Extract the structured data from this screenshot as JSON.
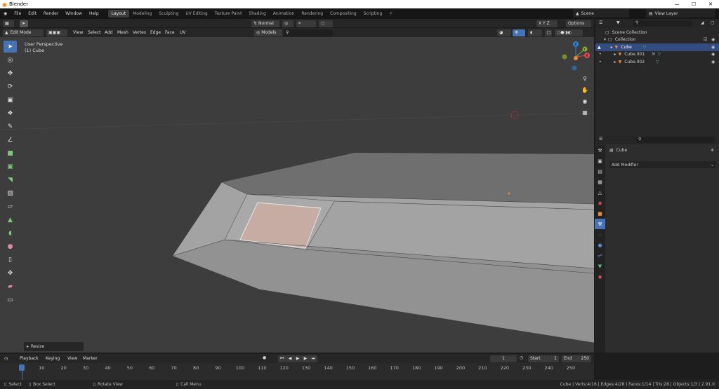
{
  "window": {
    "title": "Blender",
    "controls": [
      "—",
      "☐",
      "✕"
    ]
  },
  "menu": [
    "File",
    "Edit",
    "Render",
    "Window",
    "Help"
  ],
  "workspaces": [
    "Layout",
    "Modeling",
    "Sculpting",
    "UV Editing",
    "Texture Paint",
    "Shading",
    "Animation",
    "Rendering",
    "Compositing",
    "Scripting"
  ],
  "workspace_add": "+",
  "scene": {
    "label": "Scene",
    "view_layer": "View Layer"
  },
  "header": {
    "mode": "Edit Mode",
    "menus": [
      "View",
      "Select",
      "Add",
      "Mesh",
      "Vertex",
      "Edge",
      "Face",
      "UV"
    ],
    "orientation": "Normal",
    "orientation_drop": "Models",
    "options": "Options"
  },
  "viewport": {
    "perspective": "User Perspective",
    "object": "(1) Cube",
    "operator": "Resize"
  },
  "gizmo": {
    "z": "Z",
    "y": "Y",
    "x": "X"
  },
  "outliner": {
    "root": "Scene Collection",
    "collection": "Collection",
    "items": [
      "Cube",
      "Cube.001",
      "Cube.002"
    ]
  },
  "properties": {
    "object": "Cube",
    "modifier": "Add Modifier"
  },
  "timeline": {
    "menus": [
      "Playback",
      "Keying",
      "View",
      "Marker"
    ],
    "current_frame": "1",
    "start_label": "Start",
    "start": "1",
    "end_label": "End",
    "end": "250",
    "ticks": [
      "1",
      "10",
      "20",
      "30",
      "40",
      "50",
      "60",
      "70",
      "80",
      "90",
      "100",
      "110",
      "120",
      "130",
      "140",
      "150",
      "160",
      "170",
      "180",
      "190",
      "200",
      "210",
      "220",
      "230",
      "240",
      "250"
    ]
  },
  "status": {
    "select": "Select",
    "box_select": "Box Select",
    "rotate": "Rotate View",
    "call_menu": "Call Menu",
    "stats": "Cube | Verts:4/16 | Edges:4/28 | Faces:1/14 | Tris:28 | Objects:1/3 | 2.91.0"
  },
  "colors": {
    "accent": "#4772b3",
    "face_selected": "#c6aca2",
    "x_axis": "#e04757",
    "y_axis": "#8ab22a",
    "z_axis": "#2f80d6"
  }
}
